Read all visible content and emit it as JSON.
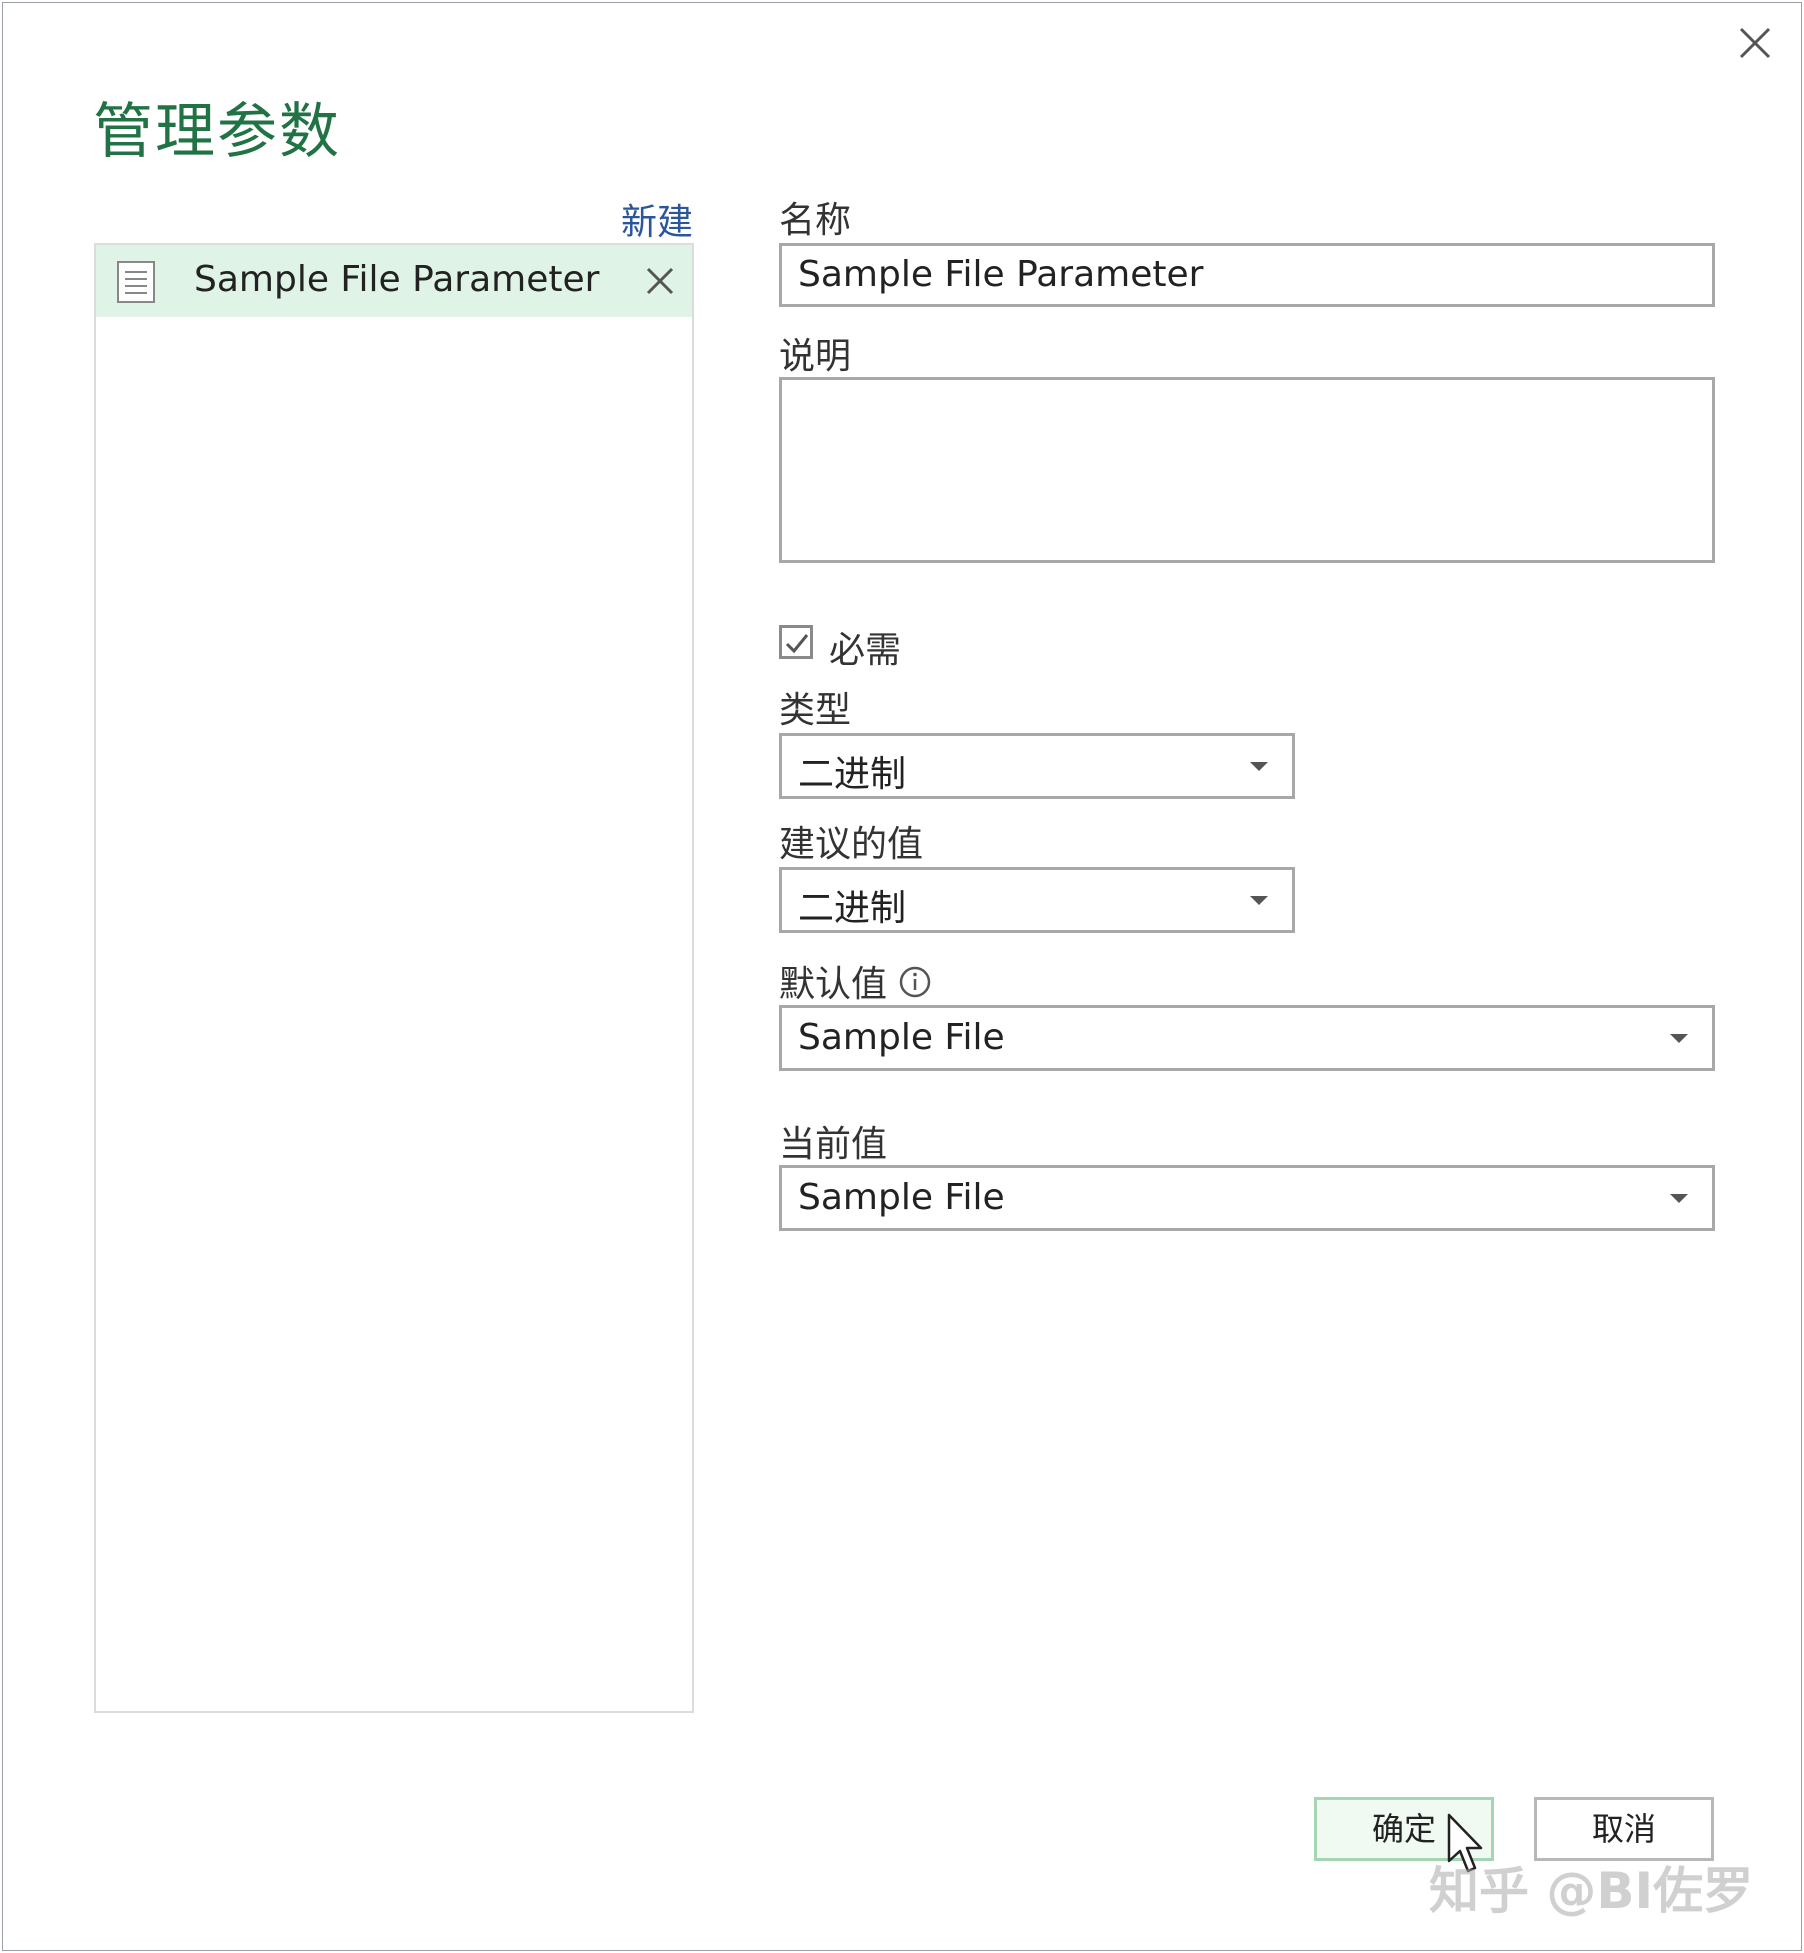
{
  "dialog": {
    "title": "管理参数",
    "new_link": "新建"
  },
  "parameter_list": {
    "items": [
      {
        "label": "Sample File Parameter"
      }
    ]
  },
  "form": {
    "name_label": "名称",
    "name_value": "Sample File Parameter",
    "description_label": "说明",
    "description_value": "",
    "required_label": "必需",
    "required_checked": true,
    "type_label": "类型",
    "type_value": "二进制",
    "suggested_label": "建议的值",
    "suggested_value": "二进制",
    "default_label": "默认值",
    "default_value": "Sample File",
    "current_label": "当前值",
    "current_value": "Sample File"
  },
  "buttons": {
    "ok": "确定",
    "cancel": "取消"
  },
  "watermark": "知乎 @BI佐罗",
  "colors": {
    "title": "#217346",
    "link": "#2b579a",
    "selected_item_bg": "#dff3e6"
  }
}
